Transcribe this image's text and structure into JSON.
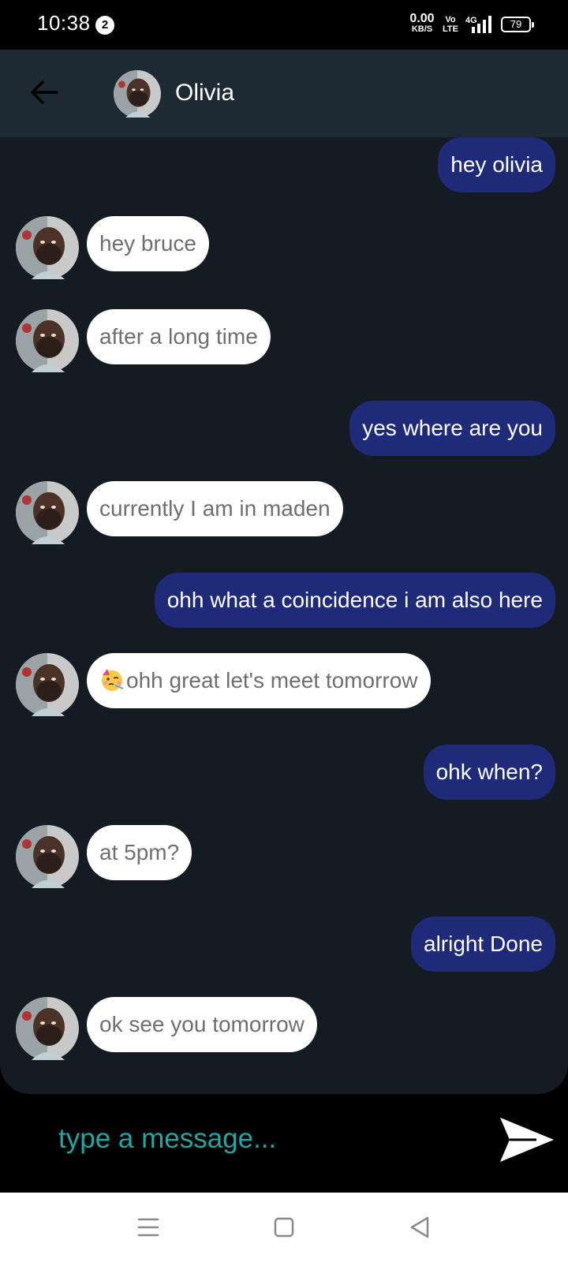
{
  "status_bar": {
    "time": "10:38",
    "notification_count": "2",
    "net_speed_value": "0.00",
    "net_speed_unit": "KB/S",
    "volte_top": "Vo",
    "volte_bottom": "LTE",
    "network_type": "4G",
    "battery_level": "79"
  },
  "header": {
    "back_icon": "arrow-left-icon",
    "contact_name": "Olivia"
  },
  "messages": [
    {
      "direction": "outgoing",
      "text": "hey olivia"
    },
    {
      "direction": "incoming",
      "text": "hey bruce"
    },
    {
      "direction": "incoming",
      "text": "after a long time"
    },
    {
      "direction": "outgoing",
      "text": "yes where are you"
    },
    {
      "direction": "incoming",
      "text": "currently I am in maden"
    },
    {
      "direction": "outgoing",
      "text": "ohh what a coincidence i am also here"
    },
    {
      "direction": "incoming",
      "text": "ohh great let's meet tomorrow",
      "emoji": "partying-face-icon"
    },
    {
      "direction": "outgoing",
      "text": "ohk when?"
    },
    {
      "direction": "incoming",
      "text": "at 5pm?"
    },
    {
      "direction": "outgoing",
      "text": "alright Done"
    },
    {
      "direction": "incoming",
      "text": "ok see you tomorrow"
    }
  ],
  "composer": {
    "placeholder": "type a message...",
    "send_icon": "send-icon"
  },
  "nav_bar": {
    "icons": [
      "menu-icon",
      "home-icon",
      "back-triangle-icon"
    ]
  },
  "colors": {
    "header_bg": "#1e2a33",
    "chat_bg": "#141b22",
    "outgoing_bubble": "#1f2a78",
    "incoming_bubble": "#ffffff",
    "placeholder_accent": "#2aa3a0"
  }
}
